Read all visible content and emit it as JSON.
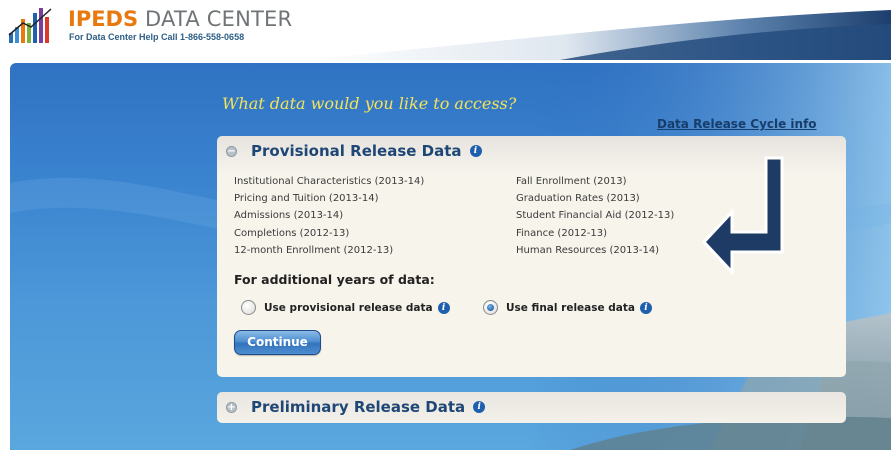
{
  "header": {
    "logo_bold": "IPEDS",
    "logo_rest": " DATA CENTER",
    "help_line": "For Data Center Help Call 1-866-558-0658",
    "logo_icon": "bar-chart-logo-icon"
  },
  "main": {
    "question": "What data would you like to access?",
    "cycle_link": "Data Release Cycle info"
  },
  "provisional": {
    "title": "Provisional Release Data",
    "toggle_symbol": "−",
    "left_items": [
      "Institutional Characteristics (2013-14)",
      "Pricing and Tuition (2013-14)",
      "Admissions (2013-14)",
      "Completions (2012-13)",
      "12-month Enrollment (2012-13)"
    ],
    "right_items": [
      "Fall Enrollment (2013)",
      "Graduation Rates (2013)",
      "Student Financial Aid (2012-13)",
      "Finance (2012-13)",
      "Human Resources (2013-14)"
    ],
    "years_label": "For additional years of data:",
    "radio_provisional": "Use provisional release data",
    "radio_final": "Use final release data",
    "selected": "final",
    "continue_label": "Continue"
  },
  "preliminary": {
    "title": "Preliminary Release Data",
    "toggle_symbol": "+"
  },
  "colors": {
    "brand_orange": "#e8790e",
    "navy": "#1f4776",
    "panel_bg": "#f5f1e8",
    "background_blue": "#3a83cf",
    "question_yellow": "#f2e35a",
    "arrow_blue": "#1e3b66"
  }
}
